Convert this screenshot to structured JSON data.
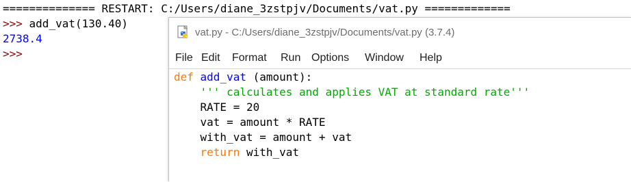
{
  "shell": {
    "restart_line": "============== RESTART: C:/Users/diane_3zstpjv/Documents/vat.py =============",
    "prompt": ">>>",
    "command": " add_vat(130.40)",
    "output": "2738.4",
    "prompt2": ">>>"
  },
  "editor": {
    "title": "vat.py - C:/Users/diane_3zstpjv/Documents/vat.py (3.7.4)",
    "menu": [
      "File",
      "Edit",
      "Format",
      "Run",
      "Options",
      "Window",
      "Help"
    ],
    "code": {
      "line1_kw": "def",
      "line1_name": " add_vat",
      "line1_rest": " (amount):",
      "line2": "    ''' calculates and applies VAT at standard rate'''",
      "line3": "    RATE = 20",
      "line4": "    vat = amount * RATE",
      "line5": "    with_vat = amount + vat",
      "line6_indent": "    ",
      "line6_kw": "return",
      "line6_rest": " with_vat"
    }
  },
  "colors": {
    "keyword": "#ff7700",
    "definition": "#0000ff",
    "string": "#00aa00",
    "prompt": "#8b0000",
    "output": "#0000ff"
  }
}
